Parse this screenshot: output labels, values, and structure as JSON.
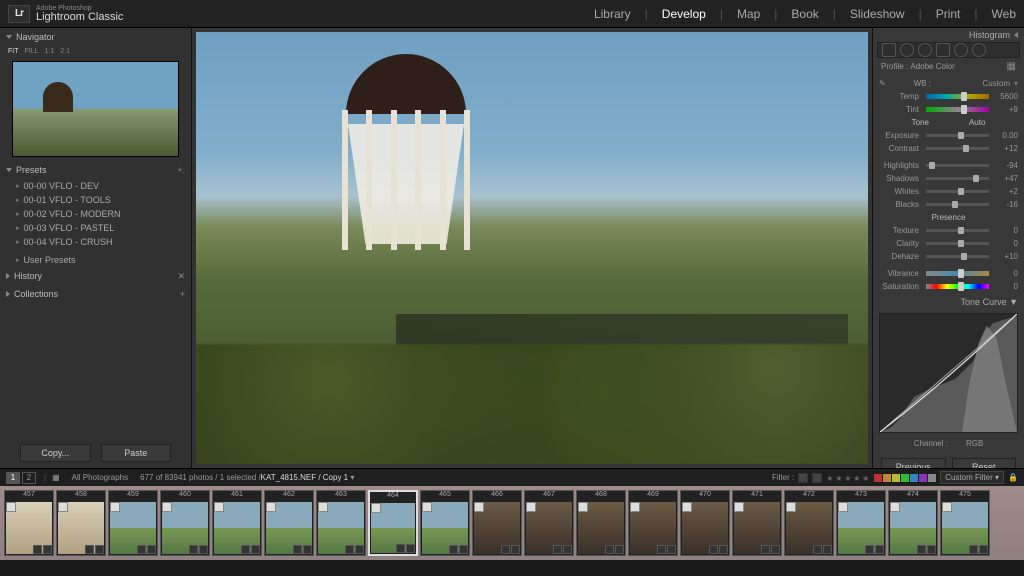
{
  "brand": {
    "line1": "Adobe Photoshop",
    "line2": "Lightroom Classic",
    "logo": "Lr"
  },
  "modules": {
    "items": [
      "Library",
      "Develop",
      "Map",
      "Book",
      "Slideshow",
      "Print",
      "Web"
    ],
    "active": "Develop"
  },
  "left": {
    "navigator": {
      "title": "Navigator",
      "fit": "FIT",
      "fill": "FILL",
      "ratio1": "1:1",
      "ratio2": "2:1"
    },
    "presets": {
      "title": "Presets",
      "items": [
        "00-00 VFLO - DEV",
        "00-01 VFLO - TOOLS",
        "00-02 VFLO - MODERN",
        "00-03 VFLO - PASTEL",
        "00-04 VFLO - CRUSH"
      ],
      "user": "User Presets"
    },
    "history": {
      "title": "History"
    },
    "collections": {
      "title": "Collections"
    },
    "copy": "Copy...",
    "paste": "Paste"
  },
  "right": {
    "histogram": "Histogram",
    "profile_label": "Profile :",
    "profile_value": "Adobe Color",
    "wb": {
      "label": "WB :",
      "mode": "Custom"
    },
    "sliders": {
      "temp": {
        "label": "Temp",
        "value": "5600",
        "pos": 55
      },
      "tint": {
        "label": "Tint",
        "value": "+9",
        "pos": 55
      },
      "tone_head": {
        "label": "Tone",
        "auto": "Auto"
      },
      "exposure": {
        "label": "Exposure",
        "value": "0.00",
        "pos": 50
      },
      "contrast": {
        "label": "Contrast",
        "value": "+12",
        "pos": 58
      },
      "highlights": {
        "label": "Highlights",
        "value": "-94",
        "pos": 5
      },
      "shadows": {
        "label": "Shadows",
        "value": "+47",
        "pos": 74
      },
      "whites": {
        "label": "Whites",
        "value": "+2",
        "pos": 51
      },
      "blacks": {
        "label": "Blacks",
        "value": "-16",
        "pos": 42
      },
      "presence": {
        "label": "Presence"
      },
      "texture": {
        "label": "Texture",
        "value": "0",
        "pos": 50
      },
      "clarity": {
        "label": "Clarity",
        "value": "0",
        "pos": 50
      },
      "dehaze": {
        "label": "Dehaze",
        "value": "+10",
        "pos": 55
      },
      "vibrance": {
        "label": "Vibrance",
        "value": "0",
        "pos": 50
      },
      "saturation": {
        "label": "Saturation",
        "value": "0",
        "pos": 50
      }
    },
    "tonecurve": "Tone Curve",
    "channel_label": "Channel :",
    "channel_value": "RGB",
    "previous": "Previous",
    "reset": "Reset"
  },
  "info": {
    "page1": "1",
    "page2": "2",
    "source": "All Photographs",
    "count": "677 of 83941 photos / 1 selected /",
    "filename": "KAT_4815.NEF / Copy 1",
    "filter_label": "Filter :",
    "custom_filter": "Custom Filter",
    "colorchips": [
      "#b33",
      "#b83",
      "#bb3",
      "#3b3",
      "#38b",
      "#83b",
      "#888"
    ]
  },
  "filmstrip": {
    "start_index": 457,
    "selected": 464,
    "thumbs": [
      {
        "i": 457,
        "st": "bright"
      },
      {
        "i": 458,
        "st": "bright"
      },
      {
        "i": 459,
        "st": ""
      },
      {
        "i": 460,
        "st": ""
      },
      {
        "i": 461,
        "st": ""
      },
      {
        "i": 462,
        "st": ""
      },
      {
        "i": 463,
        "st": ""
      },
      {
        "i": 464,
        "st": ""
      },
      {
        "i": 465,
        "st": ""
      },
      {
        "i": 466,
        "st": "room"
      },
      {
        "i": 467,
        "st": "room"
      },
      {
        "i": 468,
        "st": "room"
      },
      {
        "i": 469,
        "st": "room"
      },
      {
        "i": 470,
        "st": "room"
      },
      {
        "i": 471,
        "st": "room"
      },
      {
        "i": 472,
        "st": "room"
      },
      {
        "i": 473,
        "st": ""
      },
      {
        "i": 474,
        "st": ""
      },
      {
        "i": 475,
        "st": ""
      }
    ]
  }
}
